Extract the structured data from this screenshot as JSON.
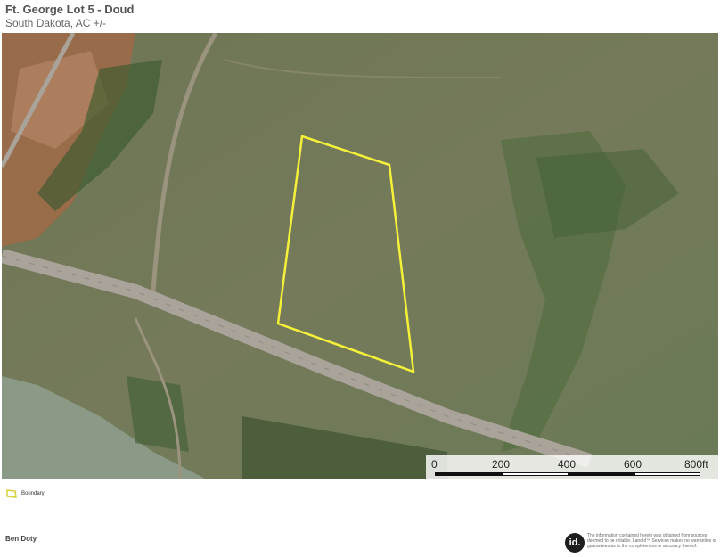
{
  "header": {
    "title": "Ft. George Lot 5 - Doud",
    "subtitle": "South Dakota,  AC +/-"
  },
  "scale_bar": {
    "labels": [
      "0",
      "200",
      "400",
      "600",
      "800ft"
    ]
  },
  "legend": {
    "items": [
      {
        "label": "Boundary",
        "color": "#f5f03a"
      }
    ]
  },
  "footer": {
    "author": "Ben Doty",
    "logo_text": "id.",
    "disclaimer": "The information contained herein was obtained from sources deemed to be reliable. LandId™ Services makes no warranties or guarantees as to the completeness or accuracy thereof."
  },
  "colors": {
    "boundary": "#f5f03a",
    "grass": "#6f7a58",
    "water": "#8a9a86",
    "road": "#a9a39a"
  }
}
